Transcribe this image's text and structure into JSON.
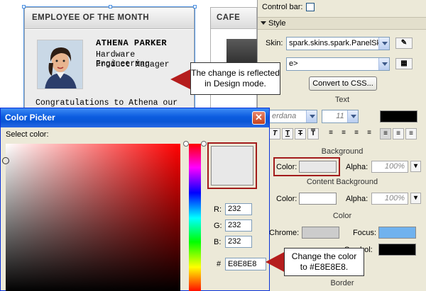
{
  "design": {
    "employee_panel": {
      "title": "EMPLOYEE OF THE MONTH",
      "name": "ATHENA PARKER",
      "role_line1": "Hardware Engineering",
      "role_line2": "Product Manager",
      "body_text": "Congratulations to Athena our"
    },
    "cafe_panel": {
      "title": "CAFE"
    }
  },
  "callouts": {
    "design_mode_line1": "The change is reflected",
    "design_mode_line2": "in Design mode.",
    "change_color_line1": "Change the color",
    "change_color_line2": "to #E8E8E8."
  },
  "properties": {
    "control_bar_label": "Control bar:",
    "style_section": "Style",
    "skin_label": "Skin:",
    "skin_value": "spark.skins.spark.PanelSk",
    "style_combo_value": "e>",
    "convert_button": "Convert to CSS...",
    "text_section": "Text",
    "font_value": "erdana",
    "font_size_value": "11",
    "format_buttons": [
      "T",
      "T",
      "T",
      "T"
    ],
    "background_section": "Background",
    "color_label": "Color:",
    "alpha_label": "Alpha:",
    "alpha_value": "100%",
    "content_background_section": "Content Background",
    "content_color_label": "Color:",
    "content_alpha_label": "Alpha:",
    "content_alpha_value": "100%",
    "color_section": "Color",
    "chrome_label": "Chrome:",
    "focus_label": "Focus:",
    "symbol_label": "Symbol:",
    "border_section": "Border",
    "colors": {
      "font_color": "#000000",
      "background_color": "#e8e8e8",
      "content_background_color": "#ffffff",
      "chrome_color": "#cccccc",
      "focus_color": "#70b2ee",
      "symbol_color": "#000000"
    }
  },
  "color_picker": {
    "title": "Color Picker",
    "select_label": "Select color:",
    "r_label": "R:",
    "g_label": "G:",
    "b_label": "B:",
    "hex_label": "#",
    "r_value": "232",
    "g_value": "232",
    "b_value": "232",
    "hex_value": "E8E8E8",
    "selected_color": "#e8e8e8"
  }
}
